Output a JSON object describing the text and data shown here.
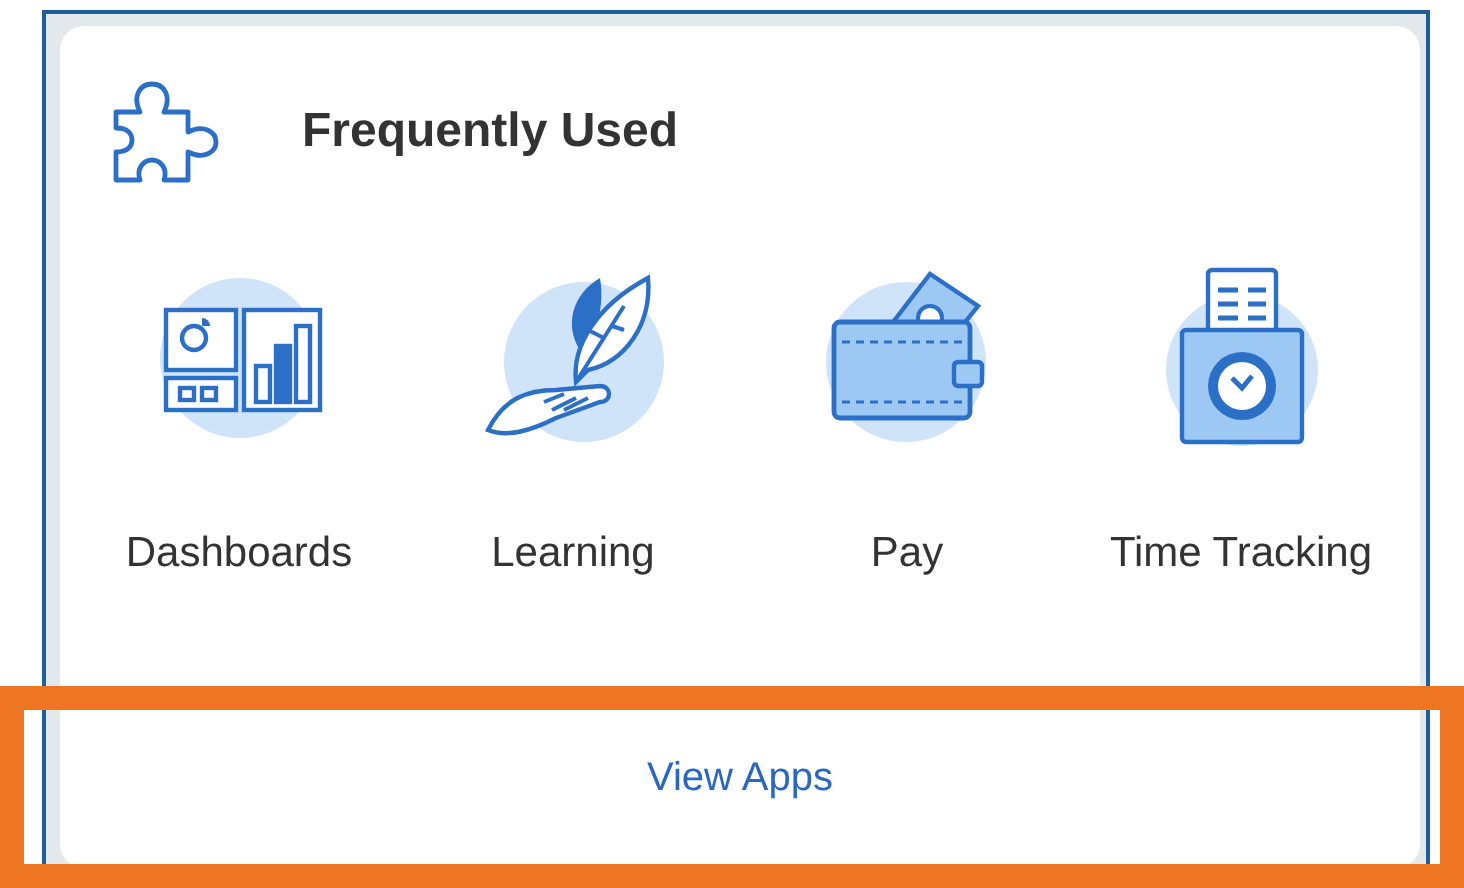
{
  "card": {
    "title": "Frequently Used",
    "apps": [
      {
        "kind": "dashboards",
        "label": "Dashboards"
      },
      {
        "kind": "learning",
        "label": "Learning"
      },
      {
        "kind": "pay",
        "label": "Pay"
      },
      {
        "kind": "time",
        "label": "Time Tracking"
      }
    ],
    "footer_link": "View Apps"
  }
}
